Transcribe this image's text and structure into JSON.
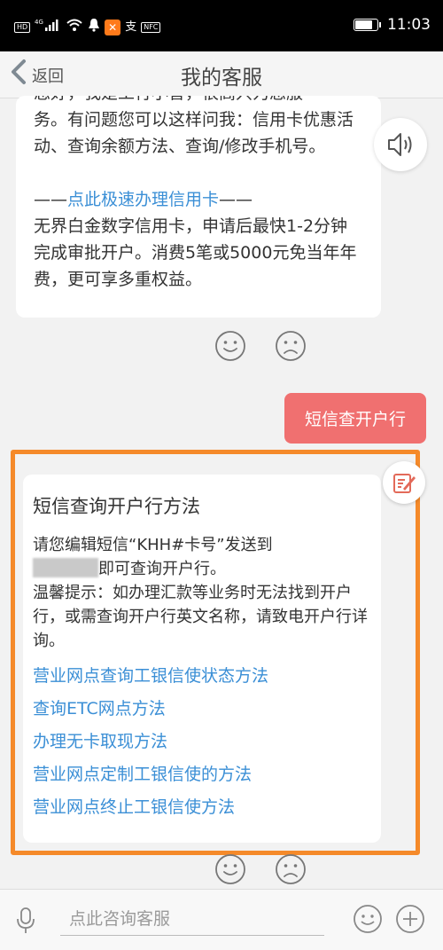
{
  "status_bar": {
    "network_tag": "HD",
    "signal_label": "4G",
    "time": "11:03"
  },
  "nav": {
    "back_label": "返回",
    "title": "我的客服"
  },
  "messages": {
    "bot_1": {
      "clipped_line": "您好，我是工行小智，很高兴为您服",
      "intro": "务。有问题您可以这样问我：信用卡优惠活动、查询余额方法、查询/修改手机号。",
      "link_prefix": "——",
      "link": "点此极速办理信用卡",
      "link_suffix": "——",
      "body": "无界白金数字信用卡，申请后最快1-2分钟完成审批开户。消费5笔或5000元免当年年费，更可享多重权益。"
    },
    "user_1": "短信查开户行",
    "bot_2": {
      "title": "短信查询开户行方法",
      "line_1": "请您编辑短信“KHH#卡号”发送到",
      "line_2": "即可查询开户行。",
      "tip": "温馨提示：如办理汇款等业务时无法找到开户行，或需查询开户行英文名称，请致电开户行详询。",
      "links": [
        "营业网点查询工银信使状态方法",
        "查询ETC网点方法",
        "办理无卡取现方法",
        "营业网点定制工银信使的方法",
        "营业网点终止工银信使方法"
      ]
    }
  },
  "input": {
    "placeholder": "点此咨询客服"
  },
  "colors": {
    "accent_link": "#3b8fd6",
    "user_bubble": "#f07070",
    "highlight": "#f58a2a"
  }
}
